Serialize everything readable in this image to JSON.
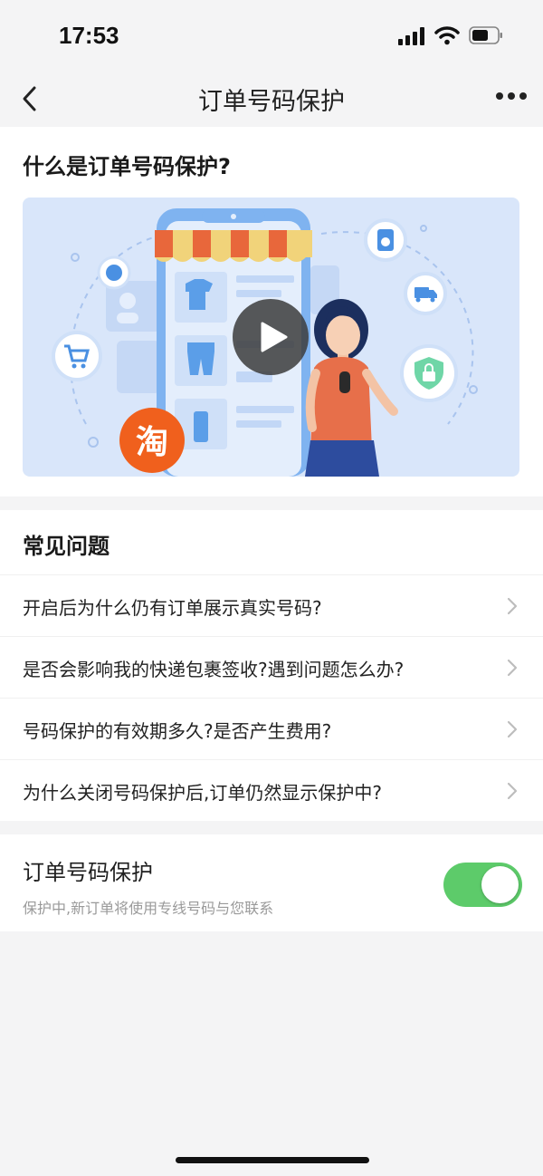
{
  "status_bar": {
    "time": "17:53",
    "icons": [
      "signal-icon",
      "wifi-icon",
      "battery-icon"
    ]
  },
  "nav": {
    "title": "订单号码保护",
    "back_icon": "chevron-left-icon",
    "more_icon": "more-icon"
  },
  "intro": {
    "title": "什么是订单号码保护?",
    "video_badge_text": "淘",
    "play_icon": "play-icon"
  },
  "faq": {
    "heading": "常见问题",
    "items": [
      {
        "question": "开启后为什么仍有订单展示真实号码?"
      },
      {
        "question": "是否会影响我的快递包裹签收?遇到问题怎么办?"
      },
      {
        "question": "号码保护的有效期多久?是否产生费用?"
      },
      {
        "question": "为什么关闭号码保护后,订单仍然显示保护中?"
      }
    ]
  },
  "protection": {
    "title": "订单号码保护",
    "subtitle": "保护中,新订单将使用专线号码与您联系",
    "enabled": true
  },
  "colors": {
    "toggle_on": "#5dcb6a",
    "page_bg": "#f4f4f5",
    "video_bg": "#d9e6fa",
    "badge_orange": "#f0601d"
  }
}
